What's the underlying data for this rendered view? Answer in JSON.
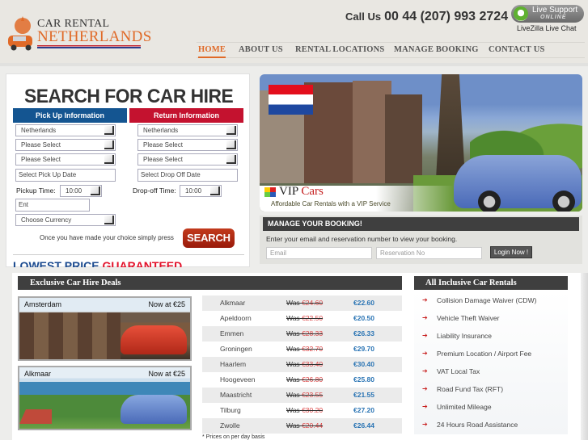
{
  "logo": {
    "line1": "CAR RENTAL",
    "line2": "NETHERLANDS"
  },
  "contact": {
    "call_label": "Call Us",
    "phone": "00 44 (207) 993 2724"
  },
  "live_support": {
    "title": "Live Support",
    "status": "ONLINE",
    "caption": "LiveZilla Live Chat"
  },
  "nav": {
    "items": [
      {
        "label": "HOME",
        "active": true
      },
      {
        "label": "ABOUT US"
      },
      {
        "label": "RENTAL LOCATIONS"
      },
      {
        "label": "MANAGE BOOKING"
      },
      {
        "label": "CONTACT US"
      }
    ]
  },
  "search": {
    "title": "SEARCH FOR CAR HIRE",
    "pickup_header": "Pick Up Information",
    "return_header": "Return Information",
    "pickup": {
      "country": "Netherlands",
      "city": "Please Select",
      "location": "Please Select",
      "date_placeholder": "Select Pick Up Date",
      "time_label": "Pickup Time:",
      "time": "10:00"
    },
    "return": {
      "country": "Netherlands",
      "city": "Please Select",
      "location": "Please Select",
      "date_placeholder": "Select Drop Off Date",
      "time_label": "Drop-off Time:",
      "time": "10:00"
    },
    "extra_field": "Ent",
    "currency": "Choose Currency",
    "press_text": "Once you have made your choice simply press",
    "search_button": "SEARCH",
    "lowest_a": "LOWEST PRICE",
    "lowest_b": "GUARANTEED"
  },
  "banner": {
    "brand_a": "VIP",
    "brand_b": "Cars",
    "tagline": "Affordable Car Rentals with a VIP Service"
  },
  "manage": {
    "header": "MANAGE YOUR BOOKING!",
    "text": "Enter your email and reservation number to view your booking.",
    "email_placeholder": "Email",
    "reservation_placeholder": "Reservation No",
    "login_button": "Login Now !"
  },
  "deals": {
    "header": "Exclusive Car Hire Deals",
    "cards": [
      {
        "city": "Amsterdam",
        "price": "Now at €25"
      },
      {
        "city": "Alkmaar",
        "price": "Now at €25"
      }
    ],
    "prices": [
      {
        "city": "Alkmaar",
        "was_label": "Was",
        "was": "€24.60",
        "now": "€22.60"
      },
      {
        "city": "Apeldoorn",
        "was_label": "Was",
        "was": "€22.50",
        "now": "€20.50"
      },
      {
        "city": "Emmen",
        "was_label": "Was",
        "was": "€28.33",
        "now": "€26.33"
      },
      {
        "city": "Groningen",
        "was_label": "Was",
        "was": "€32.70",
        "now": "€29.70"
      },
      {
        "city": "Haarlem",
        "was_label": "Was",
        "was": "€33.40",
        "now": "€30.40"
      },
      {
        "city": "Hoogeveen",
        "was_label": "Was",
        "was": "€26.80",
        "now": "€25.80"
      },
      {
        "city": "Maastricht",
        "was_label": "Was",
        "was": "€23.55",
        "now": "€21.55"
      },
      {
        "city": "Tilburg",
        "was_label": "Was",
        "was": "€30.20",
        "now": "€27.20"
      },
      {
        "city": "Zwolle",
        "was_label": "Was",
        "was": "€20.44",
        "now": "€26.44"
      }
    ],
    "note": "* Prices on per day basis"
  },
  "inclusive": {
    "header": "All Inclusive Car Rentals",
    "items": [
      "Collision Damage Waiver (CDW)",
      "Vehicle Theft Waiver",
      "Liability Insurance",
      "Premium Location / Airport Fee",
      "VAT Local Tax",
      "Road Fund Tax (RFT)",
      "Unlimited Mileage",
      "24 Hours Road Assistance"
    ]
  }
}
